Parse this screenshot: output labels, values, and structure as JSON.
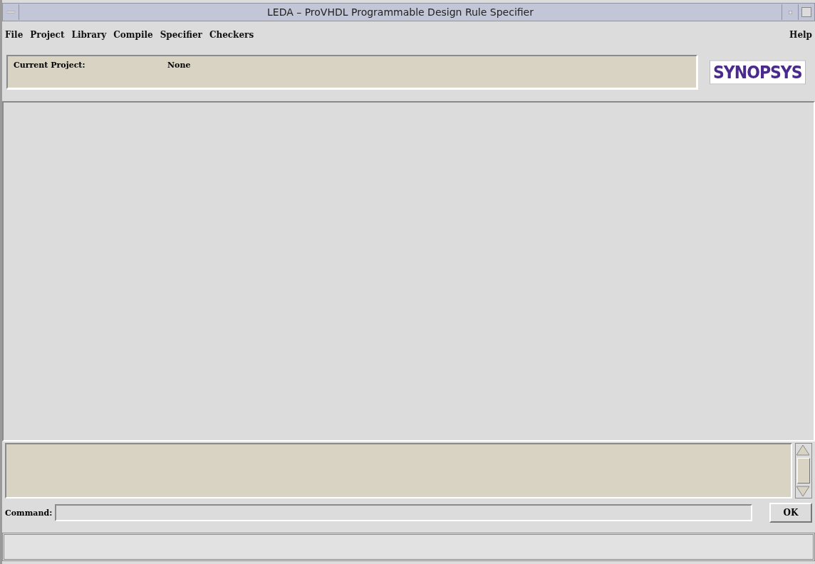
{
  "window": {
    "title": "LEDA – ProVHDL Programmable Design Rule Specifier"
  },
  "menu": {
    "items": [
      {
        "label": "File"
      },
      {
        "label": "Project"
      },
      {
        "label": "Library"
      },
      {
        "label": "Compile"
      },
      {
        "label": "Specifier"
      },
      {
        "label": "Checkers"
      }
    ],
    "help": {
      "label": "Help"
    }
  },
  "project": {
    "label": "Current Project:",
    "value": "None"
  },
  "logo": {
    "text": "SYNOPSYS"
  },
  "command": {
    "label": "Command:",
    "button": "OK"
  }
}
